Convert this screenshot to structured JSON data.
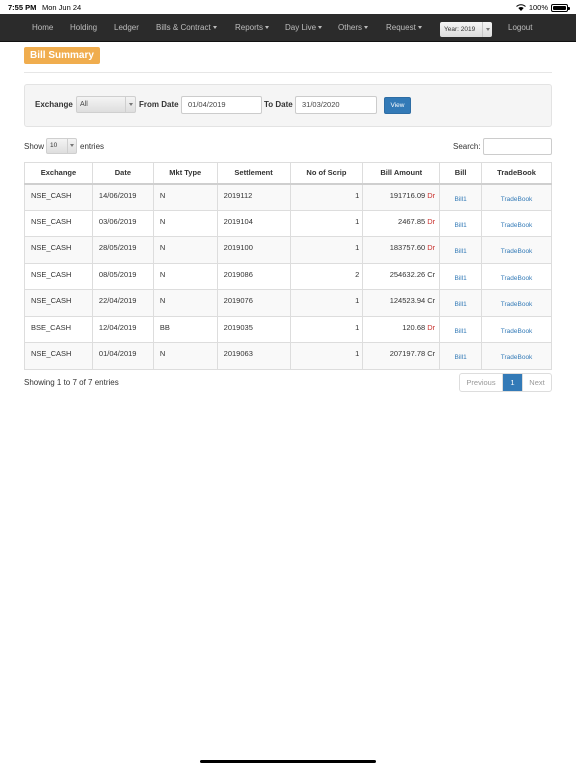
{
  "status_bar": {
    "time": "7:55 PM",
    "date": "Mon Jun 24",
    "battery": "100%"
  },
  "nav": {
    "items": [
      {
        "label": "Home",
        "dropdown": false
      },
      {
        "label": "Holding",
        "dropdown": false
      },
      {
        "label": "Ledger",
        "dropdown": false
      },
      {
        "label": "Bills & Contract",
        "dropdown": true
      },
      {
        "label": "Reports",
        "dropdown": true
      },
      {
        "label": "Day Live",
        "dropdown": true
      },
      {
        "label": "Others",
        "dropdown": true
      },
      {
        "label": "Request",
        "dropdown": true
      },
      {
        "label": "Logout",
        "dropdown": false
      }
    ],
    "year_select": "Year: 2019"
  },
  "page": {
    "title": "Bill Summary"
  },
  "filter": {
    "exchange_label": "Exchange",
    "exchange_value": "All",
    "from_label": "From Date",
    "from_value": "01/04/2019",
    "to_label": "To Date",
    "to_value": "31/03/2020",
    "view_button": "View"
  },
  "table_controls": {
    "show_label": "Show",
    "page_length": "10",
    "entries_label": "entries",
    "search_label": "Search:"
  },
  "table": {
    "headers": [
      "Exchange",
      "Date",
      "Mkt Type",
      "Settlement",
      "No of Scrip",
      "Bill Amount",
      "Bill",
      "TradeBook"
    ],
    "rows": [
      {
        "exchange": "NSE_CASH",
        "date": "14/06/2019",
        "mkt": "N",
        "settlement": "2019112",
        "scrip": "1",
        "amount": "191716.09",
        "type": "Dr",
        "bill": "Bill1",
        "tradebook": "TradeBook"
      },
      {
        "exchange": "NSE_CASH",
        "date": "03/06/2019",
        "mkt": "N",
        "settlement": "2019104",
        "scrip": "1",
        "amount": "2467.85",
        "type": "Dr",
        "bill": "Bill1",
        "tradebook": "TradeBook"
      },
      {
        "exchange": "NSE_CASH",
        "date": "28/05/2019",
        "mkt": "N",
        "settlement": "2019100",
        "scrip": "1",
        "amount": "183757.60",
        "type": "Dr",
        "bill": "Bill1",
        "tradebook": "TradeBook"
      },
      {
        "exchange": "NSE_CASH",
        "date": "08/05/2019",
        "mkt": "N",
        "settlement": "2019086",
        "scrip": "2",
        "amount": "254632.26",
        "type": "Cr",
        "bill": "Bill1",
        "tradebook": "TradeBook"
      },
      {
        "exchange": "NSE_CASH",
        "date": "22/04/2019",
        "mkt": "N",
        "settlement": "2019076",
        "scrip": "1",
        "amount": "124523.94",
        "type": "Cr",
        "bill": "Bill1",
        "tradebook": "TradeBook"
      },
      {
        "exchange": "BSE_CASH",
        "date": "12/04/2019",
        "mkt": "BB",
        "settlement": "2019035",
        "scrip": "1",
        "amount": "120.68",
        "type": "Dr",
        "bill": "Bill1",
        "tradebook": "TradeBook"
      },
      {
        "exchange": "NSE_CASH",
        "date": "01/04/2019",
        "mkt": "N",
        "settlement": "2019063",
        "scrip": "1",
        "amount": "207197.78",
        "type": "Cr",
        "bill": "Bill1",
        "tradebook": "TradeBook"
      }
    ]
  },
  "footer": {
    "info": "Showing 1 to 7 of 7 entries",
    "previous": "Previous",
    "current_page": "1",
    "next": "Next"
  },
  "colors": {
    "navbar": "#2b2b2b",
    "title_badge": "#f0ad4e",
    "primary": "#337ab7",
    "debit": "#c9302c"
  }
}
